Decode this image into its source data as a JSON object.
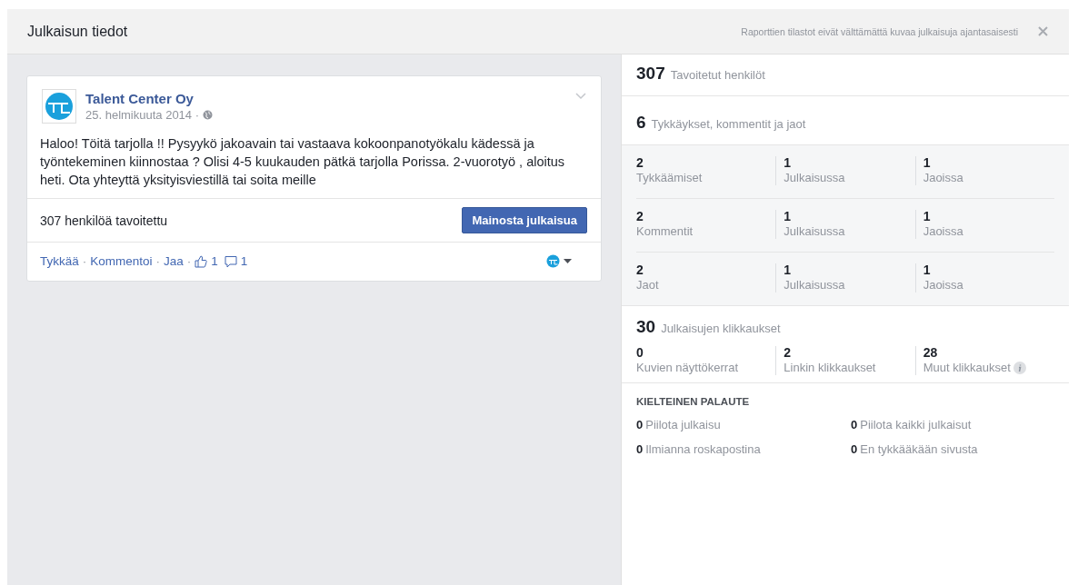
{
  "header": {
    "title": "Julkaisun tiedot",
    "notice": "Raporttien tilastot eivät välttämättä kuvaa julkaisuja ajantasaisesti"
  },
  "post": {
    "page_name": "Talent Center Oy",
    "date": "25. helmikuuta 2014 ·",
    "text": "Haloo! Töitä tarjolla !! Pysyykö jakoavain tai vastaava kokoonpanotyökalu kädessä ja työntekeminen kiinnostaa ? Olisi 4-5 kuukauden pätkä tarjolla Porissa. 2-vuorotyö , aloitus heti. Ota yhteyttä yksityisviestillä tai soita meille",
    "reach": "307 henkilöä tavoitettu",
    "promote_button": "Mainosta julkaisua",
    "actions": [
      "Tykkää",
      "Kommentoi",
      "Jaa"
    ],
    "separator": "·",
    "likes": "1",
    "comments": "1"
  },
  "stats": {
    "reached": {
      "value": "307",
      "label": "Tavoitetut henkilöt"
    },
    "engagement": {
      "value": "6",
      "label": "Tykkäykset, kommentit ja jaot"
    },
    "breakdown": [
      [
        {
          "value": "2",
          "label": "Tykkäämiset"
        },
        {
          "value": "1",
          "label": "Julkaisussa"
        },
        {
          "value": "1",
          "label": "Jaoissa"
        }
      ],
      [
        {
          "value": "2",
          "label": "Kommentit"
        },
        {
          "value": "1",
          "label": "Julkaisussa"
        },
        {
          "value": "1",
          "label": "Jaoissa"
        }
      ],
      [
        {
          "value": "2",
          "label": "Jaot"
        },
        {
          "value": "1",
          "label": "Julkaisussa"
        },
        {
          "value": "1",
          "label": "Jaoissa"
        }
      ]
    ],
    "clicks": {
      "value": "30",
      "label": "Julkaisujen klikkaukset",
      "items": [
        {
          "value": "0",
          "label": "Kuvien näyttökerrat",
          "info": false
        },
        {
          "value": "2",
          "label": "Linkin klikkaukset",
          "info": false
        },
        {
          "value": "28",
          "label": "Muut klikkaukset",
          "info": true
        }
      ]
    },
    "negative": {
      "title": "KIELTEINEN PALAUTE",
      "items": [
        {
          "value": "0",
          "label": "Piilota julkaisu"
        },
        {
          "value": "0",
          "label": "Piilota kaikki julkaisut"
        },
        {
          "value": "0",
          "label": "Ilmianna roskapostina"
        },
        {
          "value": "0",
          "label": "En tykkääkään sivusta"
        }
      ]
    }
  }
}
